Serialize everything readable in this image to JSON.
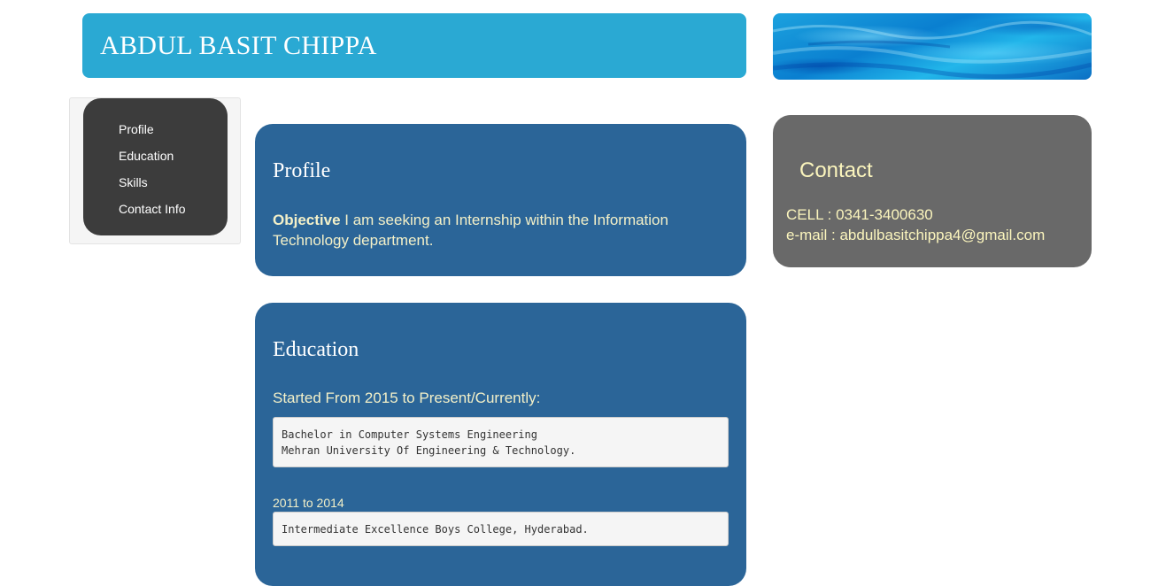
{
  "header": {
    "name": "ABDUL BASIT CHIPPA"
  },
  "nav": {
    "items": [
      {
        "label": "Profile"
      },
      {
        "label": "Education"
      },
      {
        "label": "Skills"
      },
      {
        "label": "Contact Info"
      }
    ]
  },
  "profile": {
    "heading": "Profile",
    "objective_label": "Objective",
    "objective_text": " I am seeking an Internship within the Information Technology department."
  },
  "education": {
    "heading": "Education",
    "period1": "Started From 2015 to Present/Currently:",
    "entry1_line1": "Bachelor in Computer Systems Engineering",
    "entry1_line2": "Mehran University Of Engineering & Technology.",
    "period2": "2011 to 2014",
    "entry2_line1": "Intermediate Excellence Boys College, Hyderabad."
  },
  "contact": {
    "heading": "Contact",
    "cell": "CELL : 0341-3400630",
    "email": "e-mail : abdulbasitchippa4@gmail.com"
  },
  "colors": {
    "header_bg": "#2aa9d3",
    "card_bg": "#2b6598",
    "nav_bg": "#3c3c3c",
    "contact_bg": "#696969",
    "accent_text": "#fbf5bd"
  }
}
